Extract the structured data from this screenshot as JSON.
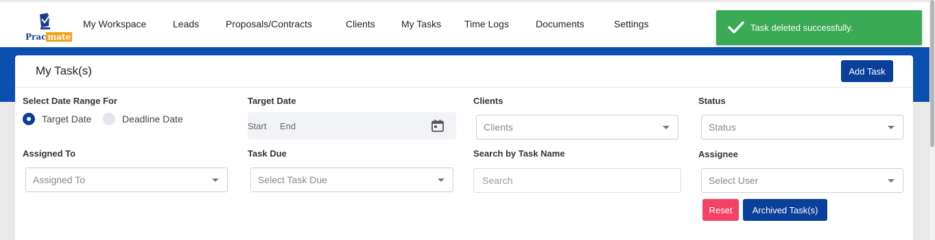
{
  "brand": {
    "logo_text_1": "Prac",
    "logo_text_2": "mate"
  },
  "nav": {
    "items": [
      {
        "label": "My Workspace"
      },
      {
        "label": "Leads"
      },
      {
        "label": "Proposals/Contracts"
      },
      {
        "label": "Clients"
      },
      {
        "label": "My Tasks"
      },
      {
        "label": "Time Logs"
      },
      {
        "label": "Documents"
      },
      {
        "label": "Settings"
      }
    ]
  },
  "toast": {
    "message": "Task deleted successfully.",
    "color": "#3aaa55"
  },
  "page": {
    "title": "My Task(s)",
    "add_button": "Add Task"
  },
  "filters": {
    "date_range": {
      "label": "Select Date Range For",
      "options": [
        {
          "label": "Target Date",
          "selected": true
        },
        {
          "label": "Deadline Date",
          "selected": false
        }
      ]
    },
    "target_date": {
      "label": "Target Date",
      "start_placeholder": "Start",
      "end_placeholder": "End"
    },
    "clients": {
      "label": "Clients",
      "placeholder": "Clients"
    },
    "status": {
      "label": "Status",
      "placeholder": "Status"
    },
    "assigned_to": {
      "label": "Assigned To",
      "placeholder": "Assigned To"
    },
    "task_due": {
      "label": "Task Due",
      "placeholder": "Select Task Due"
    },
    "search": {
      "label": "Search by Task Name",
      "placeholder": "Search"
    },
    "assignee": {
      "label": "Assignee",
      "placeholder": "Select User"
    }
  },
  "actions": {
    "reset": "Reset",
    "archived": "Archived Task(s)"
  },
  "colors": {
    "primary": "#0a3f9a",
    "band": "#0b4fb0",
    "reset": "#f44267"
  }
}
